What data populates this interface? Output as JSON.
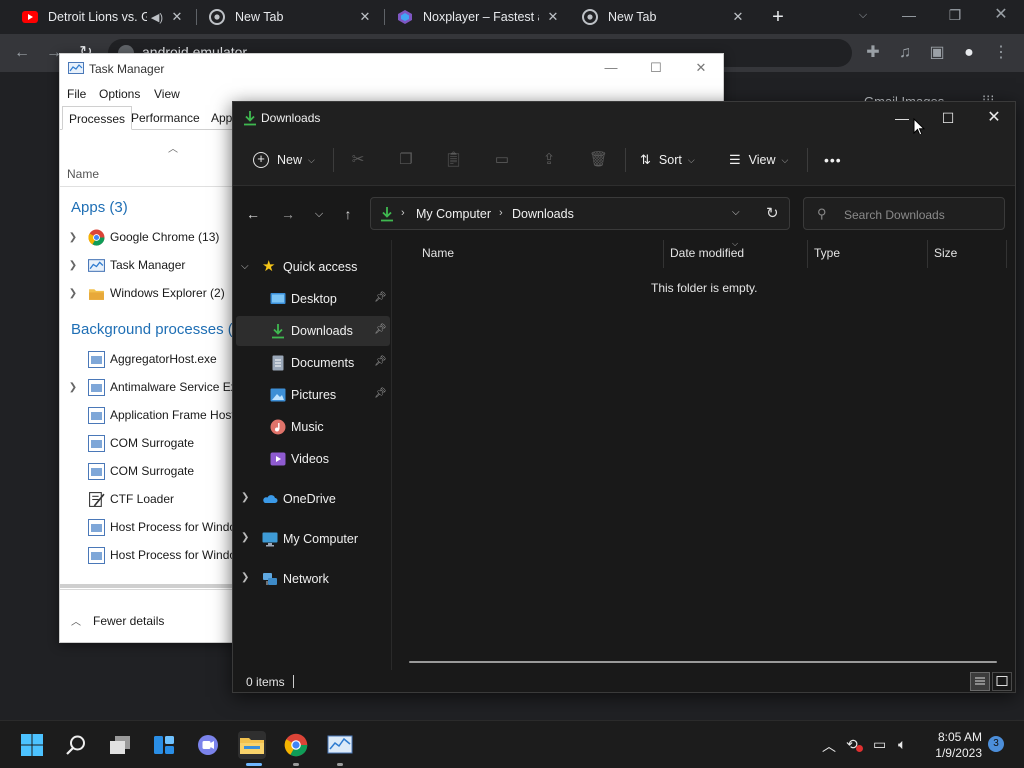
{
  "browser": {
    "tabs": [
      {
        "title": "Detroit Lions vs. Green Bay Packers",
        "icon": "youtube-icon",
        "audio": true
      },
      {
        "title": "New Tab",
        "icon": "chrome-icon"
      },
      {
        "title": "Noxplayer – Fastest and smoothest Android emulator",
        "icon": "noxplayer-icon"
      },
      {
        "title": "New Tab",
        "icon": "chrome-icon"
      }
    ],
    "omnibox_text": "android emulator",
    "ntp_links": "Gmail   Images"
  },
  "task_manager": {
    "title": "Task Manager",
    "menu": [
      "File",
      "Options",
      "View"
    ],
    "tabs": [
      "Processes",
      "Performance",
      "App history"
    ],
    "column_name": "Name",
    "apps_group": "Apps (3)",
    "apps": [
      {
        "name": "Google Chrome (13)",
        "icon": "chrome-icon"
      },
      {
        "name": "Task Manager",
        "icon": "task-manager-icon"
      },
      {
        "name": "Windows Explorer (2)",
        "icon": "folder-icon"
      }
    ],
    "background_group": "Background processes (",
    "background": [
      {
        "name": "AggregatorHost.exe",
        "expandable": false
      },
      {
        "name": "Antimalware Service Executable",
        "expandable": true
      },
      {
        "name": "Application Frame Host",
        "expandable": false
      },
      {
        "name": "COM Surrogate",
        "expandable": false
      },
      {
        "name": "COM Surrogate",
        "expandable": false
      },
      {
        "name": "CTF Loader",
        "expandable": false
      },
      {
        "name": "Host Process for Windows Tasks",
        "expandable": false
      },
      {
        "name": "Host Process for Windows Tasks",
        "expandable": false
      }
    ],
    "fewer_details": "Fewer details"
  },
  "explorer": {
    "title": "Downloads",
    "commands": {
      "new": "New",
      "sort": "Sort",
      "view": "View",
      "more": "•••"
    },
    "breadcrumb": [
      "My Computer",
      "Downloads"
    ],
    "search_placeholder": "Search Downloads",
    "sidebar": {
      "quick_access": "Quick access",
      "items": [
        {
          "label": "Desktop",
          "icon": "desktop-icon",
          "pinned": true
        },
        {
          "label": "Downloads",
          "icon": "downloads-icon",
          "pinned": true,
          "selected": true
        },
        {
          "label": "Documents",
          "icon": "documents-icon",
          "pinned": true
        },
        {
          "label": "Pictures",
          "icon": "pictures-icon",
          "pinned": true
        },
        {
          "label": "Music",
          "icon": "music-icon",
          "pinned": false
        },
        {
          "label": "Videos",
          "icon": "videos-icon",
          "pinned": false
        }
      ],
      "roots": [
        {
          "label": "OneDrive",
          "icon": "onedrive-icon"
        },
        {
          "label": "My Computer",
          "icon": "computer-icon"
        },
        {
          "label": "Network",
          "icon": "network-icon"
        }
      ]
    },
    "columns": [
      "Name",
      "Date modified",
      "Type",
      "Size"
    ],
    "empty_message": "This folder is empty.",
    "status": "0 items"
  },
  "taskbar": {
    "time": "8:05 AM",
    "date": "1/9/2023",
    "notification_count": "3"
  },
  "colors": {
    "accent_green": "#3fb950",
    "tm_link_blue": "#1f6fb5",
    "selection_bg": "#2d2d2d"
  }
}
